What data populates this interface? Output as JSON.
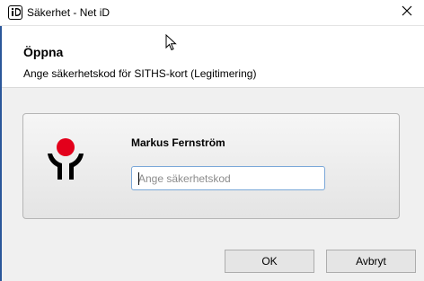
{
  "window": {
    "title": "Säkerhet - Net iD",
    "close_glyph": "✕",
    "app_icon": "net-id-icon"
  },
  "header": {
    "title": "Öppna",
    "subtitle": "Ange säkerhetskod för SITHS-kort (Legitimering)"
  },
  "card": {
    "logo": "siths-logo",
    "user_name": "Markus Fernström",
    "code_input": {
      "value": "",
      "placeholder": "Ange säkerhetskod"
    }
  },
  "buttons": {
    "ok_label": "OK",
    "cancel_label": "Avbryt"
  },
  "colors": {
    "logo_red": "#e3001b",
    "logo_black": "#000000",
    "input_focus_border": "#7aa7d8"
  }
}
